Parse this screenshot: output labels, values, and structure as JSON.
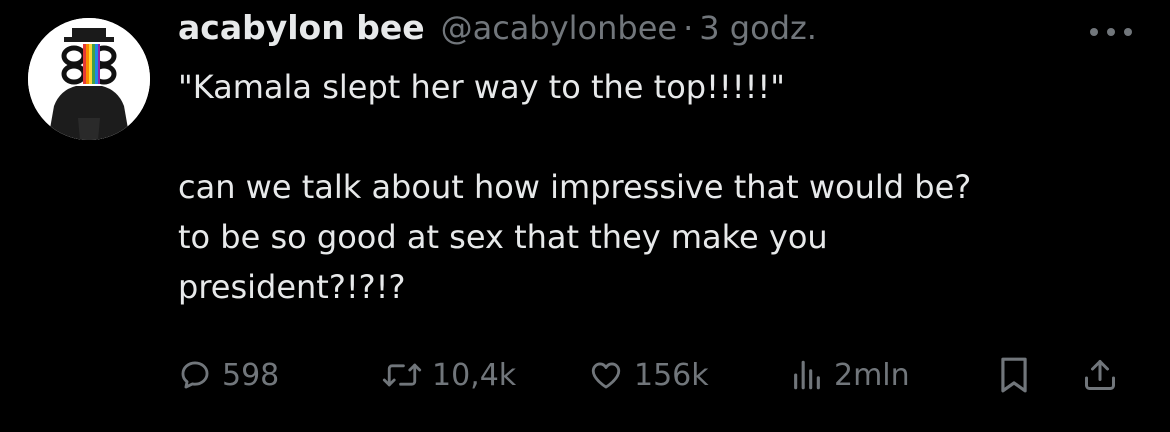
{
  "author": {
    "name": "acabylon bee",
    "handle": "@acabylonbee",
    "separator": "·",
    "time": "3 godz."
  },
  "icons": {
    "more": "more-horizontal-icon",
    "reply": "reply-icon",
    "retweet": "retweet-icon",
    "like": "heart-icon",
    "views": "views-chart-icon",
    "bookmark": "bookmark-icon",
    "share": "share-icon"
  },
  "tweet": {
    "lines": [
      "\"Kamala slept her way to the top!!!!!\"",
      "",
      "can we talk about how impressive that would be?",
      "to be so good at sex that they make you",
      "president?!?!?"
    ]
  },
  "stats": {
    "replies": "598",
    "retweets": "10,4k",
    "likes": "156k",
    "views": "2mln"
  },
  "colors": {
    "background": "#000000",
    "text": "#e7e9ea",
    "secondary": "#71767b"
  }
}
